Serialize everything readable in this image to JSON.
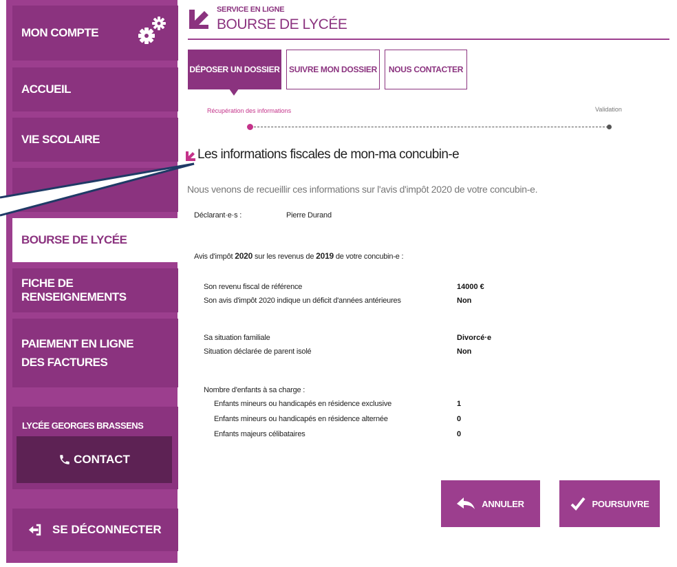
{
  "sidebar": {
    "account_label": "MON COMPTE",
    "items": [
      {
        "label": "ACCUEIL"
      },
      {
        "label": "VIE SCOLAIRE"
      },
      {
        "label": "BOURSE DE LYCÉE"
      },
      {
        "label": "FICHE DE RENSEIGNEMENTS"
      },
      {
        "label": "PAIEMENT EN LIGNE DES FACTURES"
      }
    ],
    "school_name": "LYCÉE GEORGES BRASSENS",
    "contact_label": "CONTACT",
    "logout_label": "SE DÉCONNECTER"
  },
  "header": {
    "subtitle": "SERVICE EN LIGNE",
    "title": "BOURSE DE LYCÉE"
  },
  "tabs": [
    {
      "label": "DÉPOSER UN DOSSIER",
      "active": true
    },
    {
      "label": "SUIVRE MON DOSSIER"
    },
    {
      "label": "NOUS CONTACTER"
    }
  ],
  "progress": {
    "step1": "Récupération des informations",
    "step2": "Validation"
  },
  "content": {
    "section_title": "Les informations fiscales de mon-ma concubin-e",
    "intro": "Nous venons de recueillir ces informations sur l'avis d'impôt 2020 de votre concubin-e.",
    "declarant_label": "Déclarant·e·s :",
    "declarant_value": "Pierre Durand",
    "avis_prefix": "Avis d'impôt",
    "avis_year": "2020",
    "avis_middle": "sur les revenus de",
    "revenue_year": "2019",
    "avis_suffix": "de votre concubin-e :",
    "rows": [
      {
        "label": "Son revenu fiscal de référence",
        "value": "14000 €"
      },
      {
        "label": "Son avis d'impôt 2020 indique un déficit d'années antérieures",
        "value": "Non"
      },
      {
        "label": "Sa situation familiale",
        "value": "Divorcé·e"
      },
      {
        "label": "Situation déclarée de parent isolé",
        "value": "Non"
      }
    ],
    "children_heading": "Nombre d'enfants à sa charge :",
    "children": [
      {
        "label": "Enfants mineurs ou handicapés en résidence exclusive",
        "value": "1"
      },
      {
        "label": "Enfants mineurs ou handicapés en résidence alternée",
        "value": "0"
      },
      {
        "label": "Enfants majeurs célibataires",
        "value": "0"
      }
    ]
  },
  "actions": {
    "cancel_label": "ANNULER",
    "continue_label": "POURSUIVRE"
  },
  "colors": {
    "primary": "#8b337f",
    "sidebar_bg": "#9c3e8e",
    "accent_pink": "#c4338a",
    "contact_bg": "#5d2254"
  }
}
